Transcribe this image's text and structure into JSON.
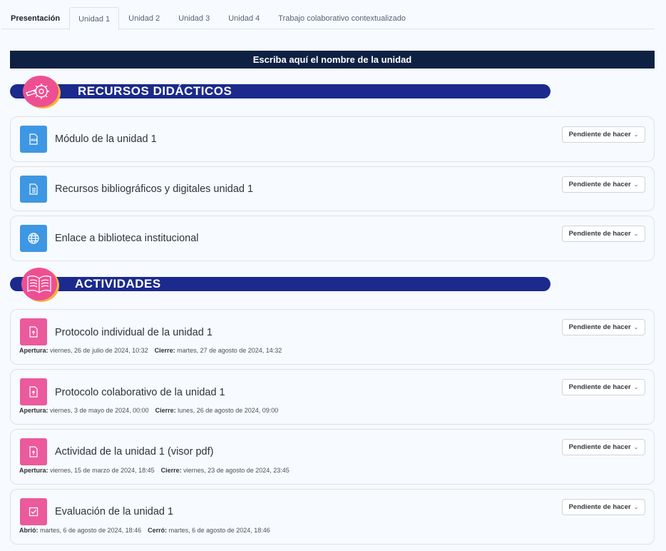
{
  "tabs": [
    {
      "label": "Presentación"
    },
    {
      "label": "Unidad 1"
    },
    {
      "label": "Unidad 2"
    },
    {
      "label": "Unidad 3"
    },
    {
      "label": "Unidad 4"
    },
    {
      "label": "Trabajo colaborativo contextualizado"
    }
  ],
  "active_tab": "Unidad 1",
  "unit_title": "Escriba aquí el nombre de la unidad",
  "sections": {
    "resources": {
      "title": "RECURSOS DIDÁCTICOS",
      "icon": "gear-pencil-icon",
      "items": [
        {
          "title": "Módulo de la unidad 1",
          "icon": "pdf-icon",
          "status": "Pendiente de hacer"
        },
        {
          "title": "Recursos bibliográficos y digitales unidad 1",
          "icon": "document-icon",
          "status": "Pendiente de hacer"
        },
        {
          "title": "Enlace a biblioteca institucional",
          "icon": "globe-icon",
          "status": "Pendiente de hacer"
        }
      ]
    },
    "activities": {
      "title": "ACTIVIDADES",
      "icon": "open-book-icon",
      "items": [
        {
          "title": "Protocolo individual de la unidad 1",
          "icon": "upload-file-icon",
          "status": "Pendiente de hacer",
          "open_label": "Apertura:",
          "open_date": "viernes, 26 de julio de 2024, 10:32",
          "close_label": "Cierre:",
          "close_date": "martes, 27 de agosto de 2024, 14:32"
        },
        {
          "title": "Protocolo colaborativo de la unidad 1",
          "icon": "upload-file-icon",
          "status": "Pendiente de hacer",
          "open_label": "Apertura:",
          "open_date": "viernes, 3 de mayo de 2024, 00:00",
          "close_label": "Cierre:",
          "close_date": "lunes, 26 de agosto de 2024, 09:00"
        },
        {
          "title": "Actividad de la unidad 1 (visor pdf)",
          "icon": "upload-file-icon",
          "status": "Pendiente de hacer",
          "open_label": "Apertura:",
          "open_date": "viernes, 15 de marzo de 2024, 18:45",
          "close_label": "Cierre:",
          "close_date": "viernes, 23 de agosto de 2024, 23:45"
        },
        {
          "title": "Evaluación de la unidad 1",
          "icon": "checkbox-icon",
          "status": "Pendiente de hacer",
          "open_label": "Abrió:",
          "open_date": "martes, 6 de agosto de 2024, 18:46",
          "close_label": "Cerró:",
          "close_date": "martes, 6 de agosto de 2024, 18:46"
        }
      ]
    }
  },
  "colors": {
    "unit_bar": "#0f2143",
    "banner": "#1b2a8c",
    "badge_pink": "#ee4f93",
    "badge_shadow": "#f7b23b",
    "resource_icon": "#3e97e3",
    "activity_icon": "#eb5a9c"
  }
}
